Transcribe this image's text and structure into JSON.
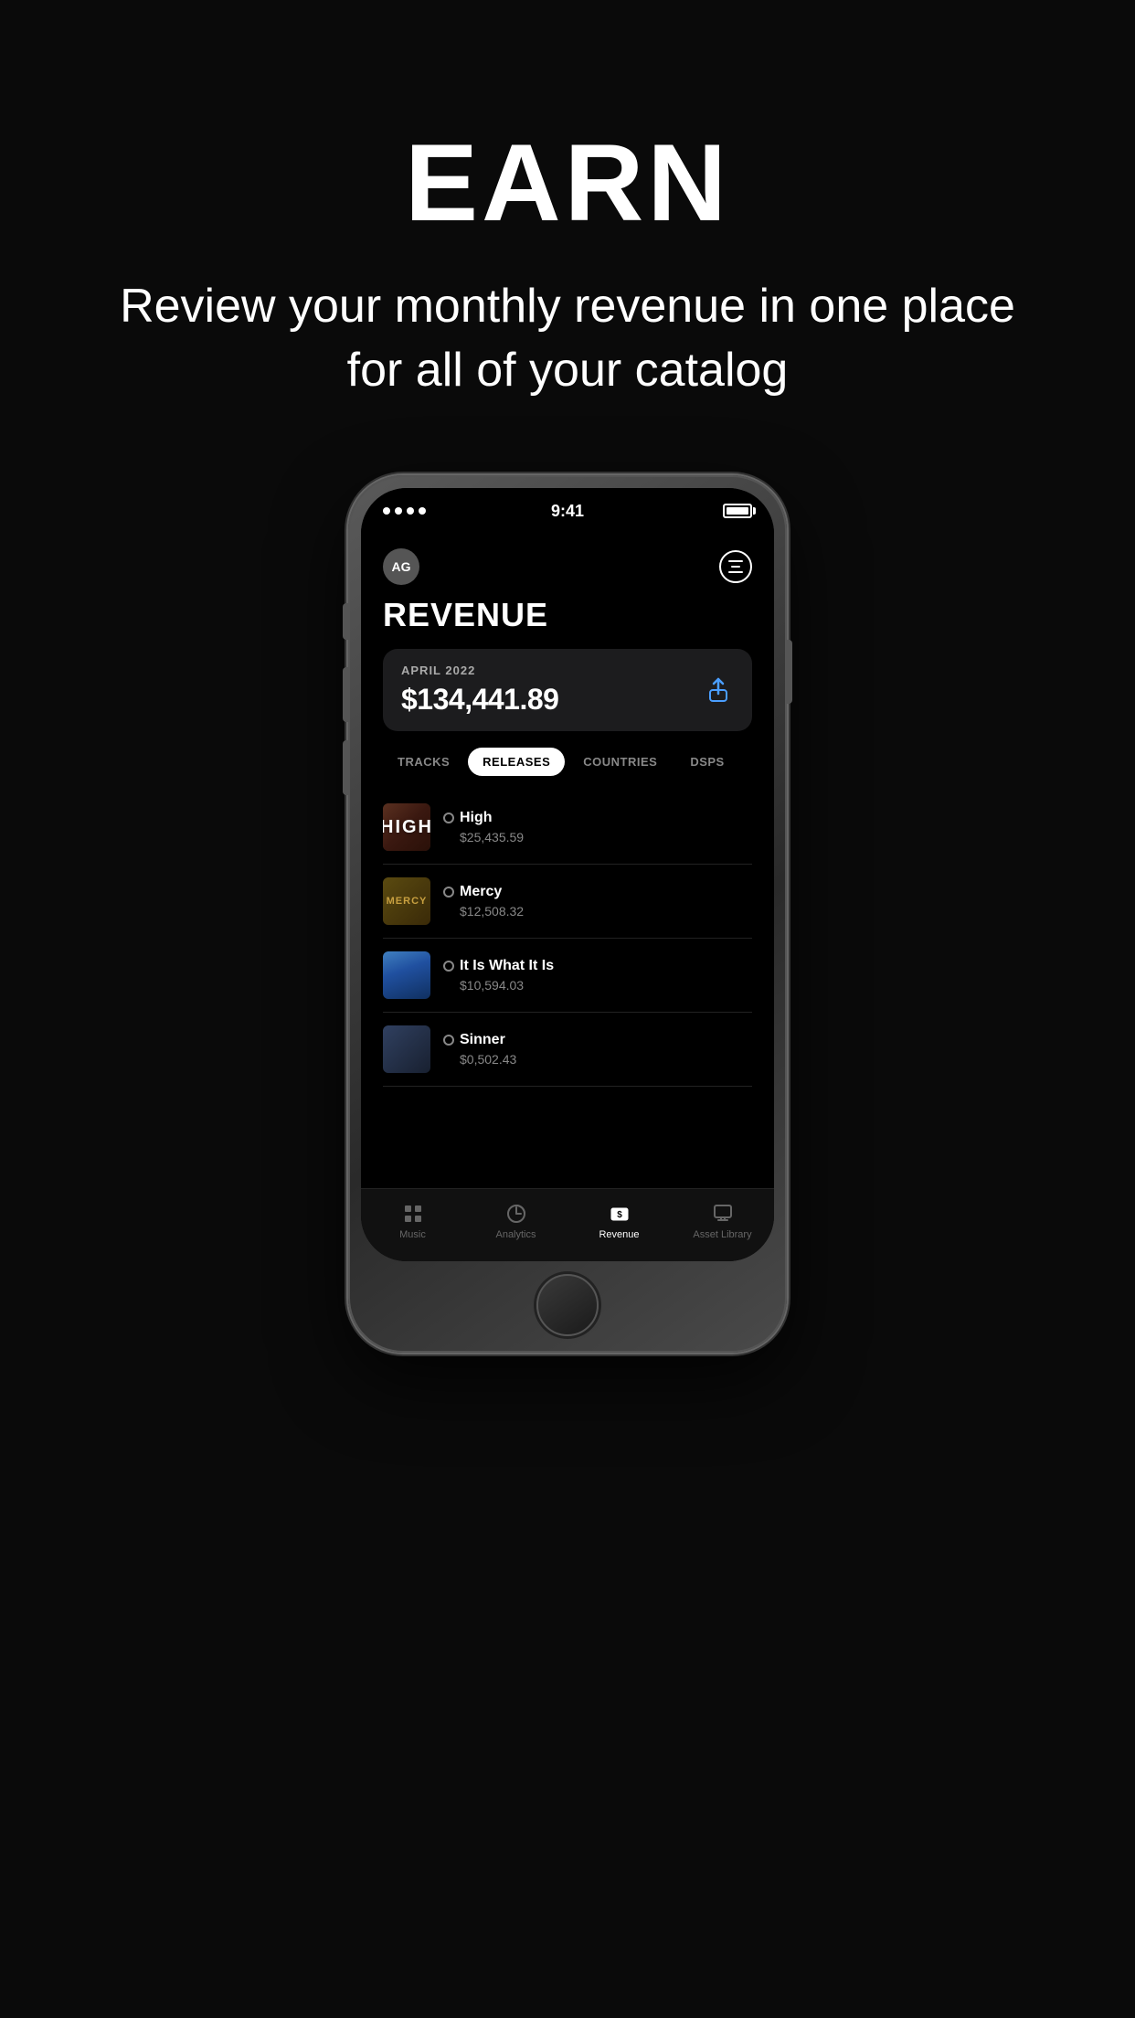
{
  "hero": {
    "title": "EARN",
    "subtitle": "Review your monthly revenue in one place for all of your catalog"
  },
  "phone": {
    "status": {
      "time": "9:41"
    },
    "app": {
      "page_title": "REVENUE",
      "avatar_initials": "AG",
      "revenue_card": {
        "month": "APRIL 2022",
        "amount": "$134,441.89"
      },
      "tabs": [
        {
          "label": "TRACKS",
          "active": false
        },
        {
          "label": "RELEASES",
          "active": true
        },
        {
          "label": "COUNTRIES",
          "active": false
        },
        {
          "label": "DSPS",
          "active": false
        }
      ],
      "releases": [
        {
          "name": "High",
          "amount": "$25,435.59",
          "thumb_color": "#4a2010"
        },
        {
          "name": "Mercy",
          "amount": "$12,508.32",
          "thumb_color": "#4a3a10"
        },
        {
          "name": "It Is What It Is",
          "amount": "$10,594.03",
          "thumb_color": "#204060"
        },
        {
          "name": "Sinner",
          "amount": "$0,502.43",
          "thumb_color": "#203040"
        }
      ],
      "bottom_nav": [
        {
          "label": "Music",
          "active": false,
          "icon": "music-icon"
        },
        {
          "label": "Analytics",
          "active": false,
          "icon": "analytics-icon"
        },
        {
          "label": "Revenue",
          "active": true,
          "icon": "revenue-icon"
        },
        {
          "label": "Asset Library",
          "active": false,
          "icon": "asset-library-icon"
        }
      ]
    }
  }
}
